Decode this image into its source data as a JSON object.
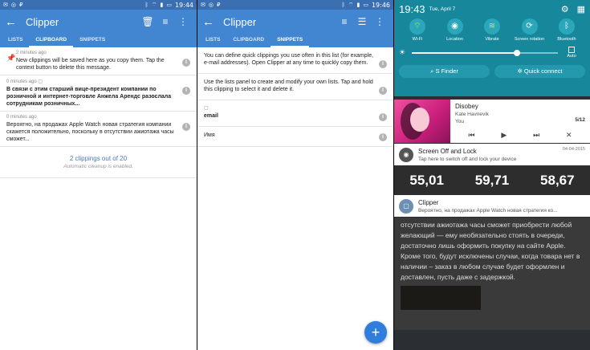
{
  "panel1": {
    "status": {
      "time": "19:44"
    },
    "appbar": {
      "title": "Clipper"
    },
    "tabs": [
      "LISTS",
      "CLIPBOARD",
      "SNIPPETS"
    ],
    "clips": [
      {
        "meta": "2 minutes ago",
        "text": "New clippings will be saved here as you copy them. Tap the context button to delete this message."
      },
      {
        "meta": "0 minutes ago",
        "text": "В связи с этим старший вице-президент компании по розничной и интернет-торговле Анжела Арендс разослала сотрудникам розничных..."
      },
      {
        "meta": "0 minutes ago",
        "text": "Вероятно, на продажах Apple Watch новая стратегия компании скажется положительно, поскольку в отсутствии ажиотажа часы сможет..."
      }
    ],
    "footer": {
      "count": "2 clippings out of 20",
      "note": "Automatic cleanup is enabled."
    }
  },
  "panel2": {
    "status": {
      "time": "19:46"
    },
    "appbar": {
      "title": "Clipper"
    },
    "tabs": [
      "LISTS",
      "CLIPBOARD",
      "SNIPPETS"
    ],
    "snippets": [
      {
        "meta": "",
        "text": "You can define quick clippings you use often in this list (for example, e-mail addresses). Open Clipper at any time to quickly copy them."
      },
      {
        "meta": "",
        "text": "Use the lists panel to create and modify your own lists. Tap and hold this clipping to select it and delete it."
      },
      {
        "meta": "",
        "text": "email"
      },
      {
        "meta": "",
        "text": "Имя"
      }
    ],
    "fab": "+"
  },
  "panel3": {
    "time": "19:43",
    "date": "Tue, April 7",
    "toggles": [
      {
        "label": "Wi-Fi",
        "icon": "wifi-icon",
        "glyph": "⌔"
      },
      {
        "label": "Location",
        "icon": "location-icon",
        "glyph": "◉"
      },
      {
        "label": "Vibrate",
        "icon": "vibrate-icon",
        "glyph": "≋"
      },
      {
        "label": "Screen rotation",
        "icon": "rotation-icon",
        "glyph": "⟳"
      },
      {
        "label": "Bluetooth",
        "icon": "bluetooth-icon",
        "glyph": "ᛒ"
      }
    ],
    "brightness_auto": "Auto",
    "brightness_level": 0.72,
    "buttons": [
      "S Finder",
      "Quick connect"
    ],
    "music": {
      "title": "Disobey",
      "artist": "Kate Havnevik",
      "album": "You",
      "counter": "5/12"
    },
    "screen_off": {
      "title": "Screen Off and Lock",
      "subtitle": "Tap here to switch off and lock your device",
      "date": "04-04-2015"
    },
    "stocks": [
      "55,01",
      "59,71",
      "58,67"
    ],
    "clipper_notif": {
      "title": "Clipper",
      "subtitle": "Вероятно, на продажах Apple Watch новая стратегия ко..."
    },
    "background_text": "отсутствии ажиотажа часы сможет приобрести любой желающий — ему необязательно стоять в очереди, достаточно лишь оформить покупку на сайте Apple. Кроме того, будут исключены случаи, когда товара нет в наличии – заказ в любом случае будет оформлен и доставлен, пусть даже с задержкой."
  },
  "colors": {
    "primary": "#4285d0",
    "status": "#3a6fb2",
    "quicksettings": "#17879c",
    "fab": "#2f7ede"
  }
}
